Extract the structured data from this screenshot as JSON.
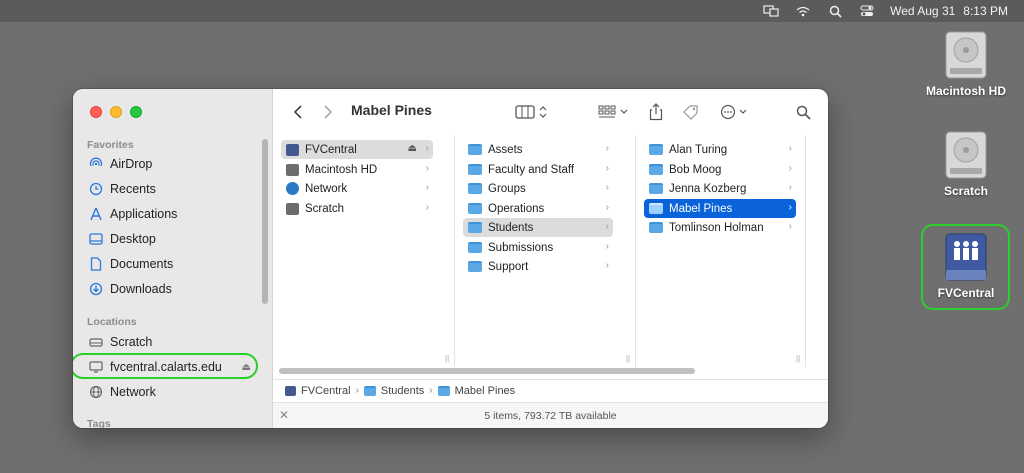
{
  "menubar": {
    "date": "Wed Aug 31",
    "time": "8:13 PM",
    "icons": [
      "display-icon",
      "wifi-icon",
      "search-icon",
      "control-center-icon"
    ]
  },
  "desktop": {
    "icons": [
      {
        "label": "Macintosh HD",
        "icon": "hard-drive-icon"
      },
      {
        "label": "Scratch",
        "icon": "hard-drive-icon"
      },
      {
        "label": "FVCentral",
        "icon": "network-volume-icon"
      }
    ]
  },
  "sidebar": {
    "favorites_header": "Favorites",
    "favorites": [
      {
        "label": "AirDrop",
        "icon": "airdrop-icon"
      },
      {
        "label": "Recents",
        "icon": "clock-icon"
      },
      {
        "label": "Applications",
        "icon": "applications-icon"
      },
      {
        "label": "Desktop",
        "icon": "desktop-icon"
      },
      {
        "label": "Documents",
        "icon": "document-icon"
      },
      {
        "label": "Downloads",
        "icon": "download-icon"
      }
    ],
    "locations_header": "Locations",
    "locations": [
      {
        "label": "Scratch",
        "icon": "drive-icon"
      },
      {
        "label": "fvcentral.calarts.edu",
        "icon": "monitor-icon",
        "eject": "⏏"
      },
      {
        "label": "Network",
        "icon": "globe-icon"
      }
    ],
    "tags_header": "Tags"
  },
  "toolbar": {
    "title": "Mabel Pines"
  },
  "columns": [
    {
      "items": [
        {
          "label": "FVCentral",
          "eject": "⏏"
        },
        {
          "label": "Macintosh HD"
        },
        {
          "label": "Network"
        },
        {
          "label": "Scratch"
        }
      ]
    },
    {
      "items": [
        {
          "label": "Assets"
        },
        {
          "label": "Faculty and Staff"
        },
        {
          "label": "Groups"
        },
        {
          "label": "Operations"
        },
        {
          "label": "Students"
        },
        {
          "label": "Submissions"
        },
        {
          "label": "Support"
        }
      ]
    },
    {
      "items": [
        {
          "label": "Alan Turing"
        },
        {
          "label": "Bob Moog"
        },
        {
          "label": "Jenna Kozberg"
        },
        {
          "label": "Mabel Pines"
        },
        {
          "label": "Tomlinson Holman"
        }
      ]
    }
  ],
  "pathbar": [
    "FVCentral",
    "Students",
    "Mabel Pines"
  ],
  "status": "5 items, 793.72 TB available",
  "colors": {
    "selection_blue": "#0a63d9",
    "highlight_green": "#2ad12a",
    "folder_blue": "#5aa8e6"
  }
}
